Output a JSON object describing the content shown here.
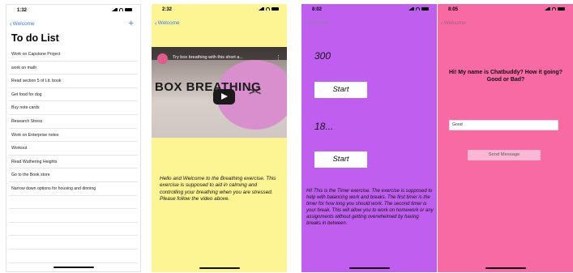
{
  "screen1": {
    "time": "1:32",
    "back_label": "Welcome",
    "add_label": "+",
    "title": "To do List",
    "items": [
      "Work on Capstone Project",
      "work on math",
      "Read section 5 of Lit. book",
      "Get food for dog",
      "Buy note cards",
      "Research Stress",
      "Work on Enterprise notes",
      "Workout",
      "Read Wuthering Heights",
      "Go to the Book store",
      "Narrow down options for housing and dinning"
    ]
  },
  "screen2": {
    "time": "2:32",
    "back_label": "Welcome",
    "video_title": "Try box breathing with this short a...",
    "video_overlay_text": "BOX BREATHING",
    "description": "Hello and Welcome to the Breathing exercise. This exercise is supposed to aid in calming and controlling your breathing when you are stressed. Please follow the video above."
  },
  "screen3": {
    "time": "8:02",
    "back_label": "Welcome",
    "timer1_value": "300",
    "timer2_value": "18...",
    "start_label": "Start",
    "description": "Hi! This is the Timer exercise. The exercise is supposed to help with balancing work and breaks. The first timer is the timer for how long you should work. The second timer is your break. This will allow you to work on homework or any assignments without getting overwhelmed by having breaks in between."
  },
  "screen4": {
    "time": "8:05",
    "back_label": "Welcome",
    "message": "Hi! My name is Chatbuddy? How it going? Good or Bad?",
    "input_value": "Good",
    "send_label": "Send Message"
  },
  "colors": {
    "ios_blue": "#2f7bf6",
    "breathing_bg": "#fdf594",
    "timer_bg": "#c05ef0",
    "chat_bg": "#f76aa3"
  }
}
